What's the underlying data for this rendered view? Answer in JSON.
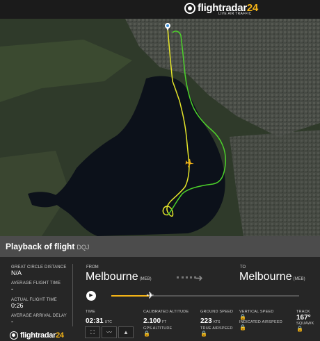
{
  "header": {
    "brand_main": "flightradar",
    "brand_num": "24",
    "tagline": "LIVE AIR TRAFFIC"
  },
  "playback": {
    "title": "Playback of flight",
    "flight_code": "DQJ"
  },
  "stats": {
    "great_circle_label": "GREAT CIRCLE DISTANCE",
    "great_circle_value": "N/A",
    "avg_flight_time_label": "AVERAGE FLIGHT TIME",
    "avg_flight_time_value": "-",
    "actual_flight_time_label": "ACTUAL FLIGHT TIME",
    "actual_flight_time_value": "0:26",
    "avg_arrival_delay_label": "AVERAGE ARRIVAL DELAY",
    "avg_arrival_delay_value": "-"
  },
  "route": {
    "from_label": "FROM",
    "from_city": "Melbourne",
    "from_code": "(MEB)",
    "to_label": "TO",
    "to_city": "Melbourne",
    "to_code": "(MEB)"
  },
  "progress": 0.2,
  "metrics": {
    "time_label": "TIME",
    "time_value": "02:31",
    "time_unit": "UTC",
    "cal_alt_label": "CALIBRATED ALTITUDE",
    "cal_alt_value": "2.100",
    "cal_alt_unit": "FT",
    "gps_alt_label": "GPS ALTITUDE",
    "ground_speed_label": "GROUND SPEED",
    "ground_speed_value": "223",
    "ground_speed_unit": "KTS",
    "true_airspeed_label": "TRUE AIRSPEED",
    "vertical_speed_label": "VERTICAL SPEED",
    "indicated_airspeed_label": "INDICATED AIRSPEED",
    "track_label": "TRACK",
    "track_value": "167°",
    "squawk_label": "SQUAWK"
  },
  "colors": {
    "accent": "#f5b417",
    "track_yellow": "#e6e62a",
    "track_green": "#4cd12a"
  }
}
